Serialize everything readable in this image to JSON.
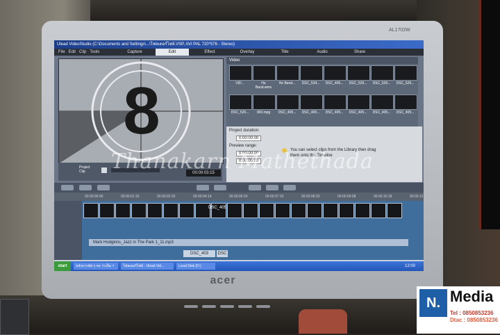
{
  "monitor": {
    "brand": "acer",
    "model": "AL1702W"
  },
  "app": {
    "title": "Ulead VideoStudio (C:\\Documents and Settings\\...\\โฟลเดอร์ไฟล์.VSP, AVI PAL 720*576 - Stereo)",
    "menu": [
      "File",
      "Edit",
      "Clip",
      "Tools"
    ],
    "tabs": [
      "Capture",
      "Edit",
      "Effect",
      "Overlay",
      "Title",
      "Audio",
      "Share"
    ],
    "active_tab": "Edit",
    "preview_number": "8",
    "preview_label": "Project Clip",
    "timecode": "00:00:03:15",
    "library_header": "Video",
    "thumbnails": [
      "VID...",
      "He Band.wmv",
      "He Band...",
      "DSC_534...",
      "DSC_405...",
      "DSC_526...",
      "DSC_526...",
      "DSC_526...",
      "DSC_526...",
      "000.mpg",
      "DSC_405...",
      "DSC_405...",
      "DSC_405...",
      "DSC_405...",
      "DSC_405...",
      "DSC_405..."
    ],
    "options": {
      "project_duration": "Project duration:",
      "duration_value": "0:00:00:00",
      "preview_range": "Preview range:",
      "range_start": "0:00:00:00",
      "range_end": "0:00:00:00",
      "hint": "You can select clips from the Library then drag them onto the Timeline"
    },
    "ruler": [
      "00:00:00:00",
      "00:00:01:10",
      "00:00:02:20",
      "00:00:04:14",
      "00:00:05:24",
      "00:00:07:10",
      "00:00:08:20",
      "00:00:09:08",
      "00:00:10:18",
      "00:00:12:14"
    ],
    "audio_clip": "Mark Hodgkins_Jazz in The Park 1_11.mp3",
    "clip_labels": [
      "DSC_405",
      "DSC_403",
      "DSC"
    ],
    "taskbar": {
      "start": "start",
      "tasks": [
        "หลังจากอัพ ๆ กด ว่าเป็น ฯ",
        "โฟลเดอร์ไฟล์ - Ulead Vid...",
        "Local Disk (D:)"
      ],
      "clock": "12:00"
    }
  },
  "watermark": "Thanakarn Mathethada",
  "logo": {
    "letter": "N.",
    "name": "Media",
    "tel": "Tel : 0850853236",
    "dtac": "Dtac : 0850853236"
  }
}
